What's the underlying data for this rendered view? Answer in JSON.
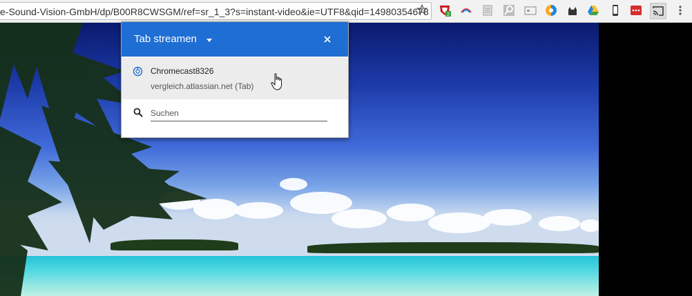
{
  "browser": {
    "url": "e-Sound-Vision-GmbH/dp/B00R8CWSGM/ref=sr_1_3?s=instant-video&ie=UTF8&qid=14980354678",
    "bookmark_icon": "star-icon",
    "extensions": [
      {
        "name": "ublock-icon",
        "badge": "2"
      },
      {
        "name": "rainbow-icon"
      },
      {
        "name": "document-icon"
      },
      {
        "name": "image-search-icon"
      },
      {
        "name": "card-icon"
      },
      {
        "name": "colorful-orb-icon"
      },
      {
        "name": "cat-icon"
      },
      {
        "name": "google-drive-icon"
      },
      {
        "name": "phone-icon"
      },
      {
        "name": "red-menu-icon"
      },
      {
        "name": "cast-icon"
      },
      {
        "name": "kebab-menu-icon"
      }
    ]
  },
  "cast_popup": {
    "title": "Tab streamen",
    "device": {
      "name": "Chromecast8326",
      "subtitle": "vergleich.atlassian.net (Tab)"
    },
    "search": {
      "placeholder": "Suchen",
      "value": ""
    },
    "accent_color": "#1e6ed4"
  }
}
